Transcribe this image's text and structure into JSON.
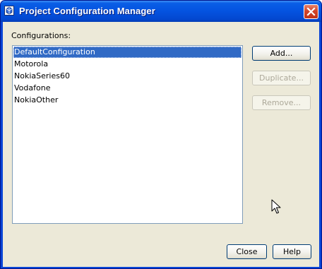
{
  "window": {
    "title": "Project Configuration Manager",
    "icon": "app-icon",
    "close_icon": "close-icon"
  },
  "configurations": {
    "label": "Configurations:",
    "items": [
      {
        "label": "DefaultConfiguration",
        "selected": true
      },
      {
        "label": "Motorola",
        "selected": false
      },
      {
        "label": "NokiaSeries60",
        "selected": false
      },
      {
        "label": "Vodafone",
        "selected": false
      },
      {
        "label": "NokiaOther",
        "selected": false
      }
    ]
  },
  "actions": {
    "add": {
      "label": "Add...",
      "enabled": true
    },
    "duplicate": {
      "label": "Duplicate...",
      "enabled": false
    },
    "remove": {
      "label": "Remove...",
      "enabled": false
    }
  },
  "footer": {
    "close": {
      "label": "Close"
    },
    "help": {
      "label": "Help"
    }
  },
  "colors": {
    "title_bar": "#0453e0",
    "selection": "#316ac5",
    "dialog_bg": "#ece9d8"
  }
}
